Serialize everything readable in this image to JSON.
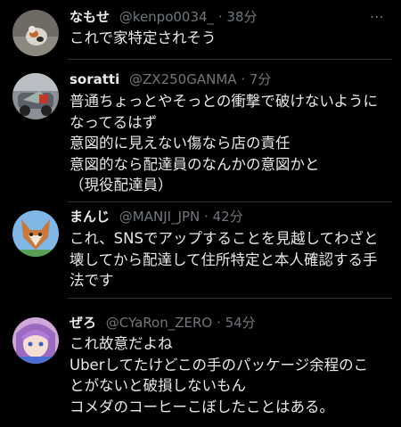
{
  "tweets": [
    {
      "name": "なもせ",
      "handle": "@kenpo0034_",
      "time": "38分",
      "text": "これで家特定されそう",
      "avatar_icon": "cat-photo-avatar"
    },
    {
      "name": "soratti",
      "handle": "@ZX250GANMA",
      "time": "7分",
      "text": "普通ちょっとやそっとの衝撃で破けないように\nなってるはず\n意図的に見えない傷なら店の責任\n意図的なら配達員のなんかの意図かと\n（現役配達員）",
      "avatar_icon": "motorcycle-photo-avatar"
    },
    {
      "name": "まんじ",
      "handle": "@MANJI_JPN",
      "time": "42分",
      "text": "これ、SNSでアップすることを見越してわざと\n壊してから配達して住所特定と本人確認する手\n法です",
      "avatar_icon": "fox-illustration-avatar"
    },
    {
      "name": "ぜろ",
      "handle": "@CYaRon_ZERO",
      "time": "54分",
      "text": "これ故意だよね\nUberしてたけどこの手のパッケージ余程のこ\nとがないと破損しないもん\nコメダのコーヒーこぼしたことはある。",
      "avatar_icon": "anime-character-avatar"
    }
  ],
  "more_icon_label": "⋯"
}
